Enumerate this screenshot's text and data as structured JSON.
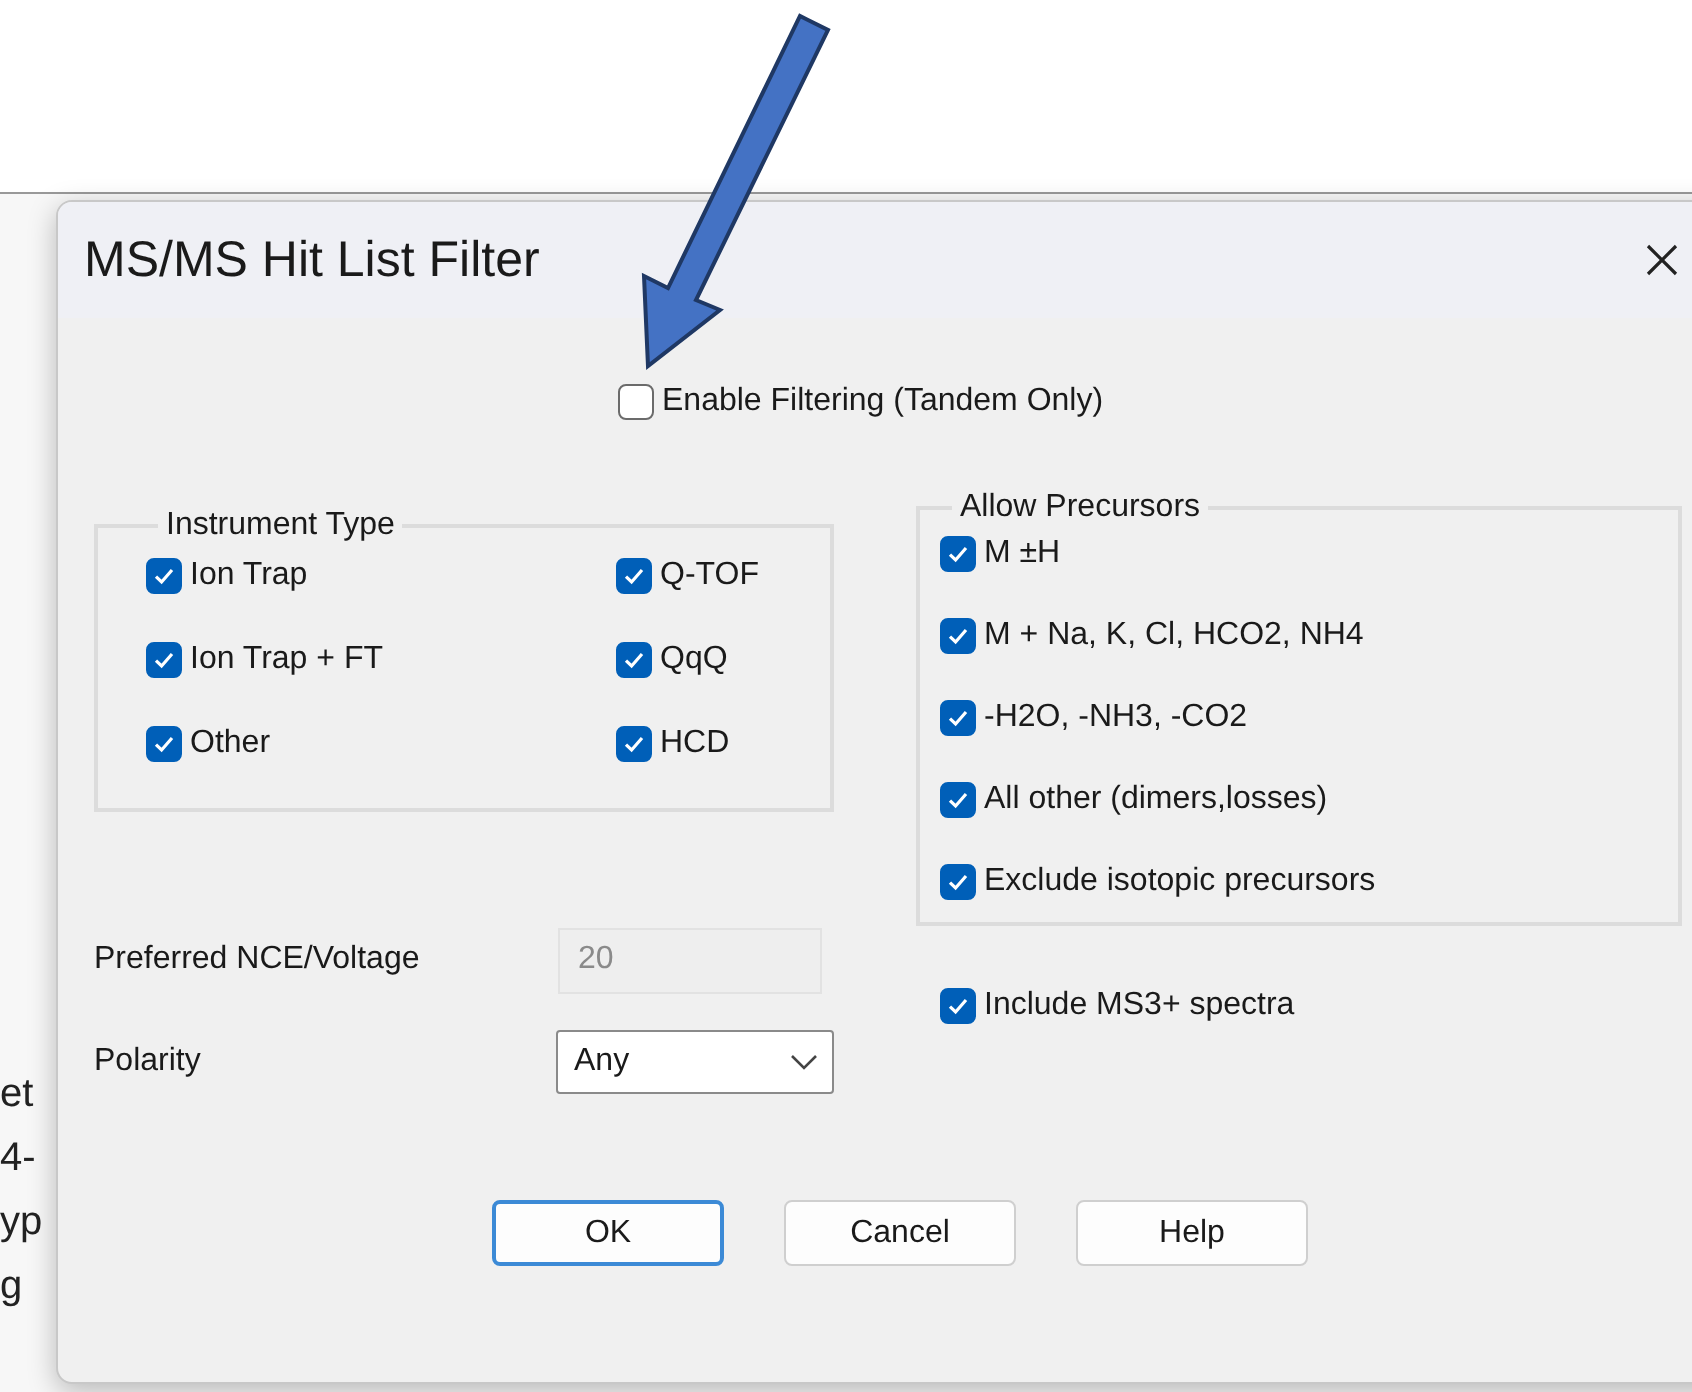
{
  "background_fragments": [
    "et",
    "4-",
    "yp",
    "g"
  ],
  "dialog": {
    "title": "MS/MS Hit List Filter",
    "enable_filtering": {
      "label": "Enable Filtering (Tandem Only)",
      "checked": false
    },
    "instrument_type": {
      "title": "Instrument Type",
      "options": [
        {
          "label": "Ion Trap",
          "checked": true
        },
        {
          "label": "Q-TOF",
          "checked": true
        },
        {
          "label": "Ion Trap + FT",
          "checked": true
        },
        {
          "label": "QqQ",
          "checked": true
        },
        {
          "label": "Other",
          "checked": true
        },
        {
          "label": "HCD",
          "checked": true
        }
      ]
    },
    "allow_precursors": {
      "title": "Allow Precursors",
      "options": [
        {
          "label": "M ±H",
          "checked": true
        },
        {
          "label": "M + Na, K, Cl, HCO2, NH4",
          "checked": true
        },
        {
          "label": "-H2O, -NH3, -CO2",
          "checked": true
        },
        {
          "label": "All other (dimers,losses)",
          "checked": true
        },
        {
          "label": "Exclude isotopic precursors",
          "checked": true
        }
      ]
    },
    "nce": {
      "label": "Preferred NCE/Voltage",
      "value": "20",
      "disabled": true
    },
    "include_ms3": {
      "label": "Include MS3+ spectra",
      "checked": true
    },
    "polarity": {
      "label": "Polarity",
      "value": "Any"
    },
    "buttons": [
      {
        "label": "OK",
        "default": true
      },
      {
        "label": "Cancel",
        "default": false
      },
      {
        "label": "Help",
        "default": false
      }
    ]
  }
}
